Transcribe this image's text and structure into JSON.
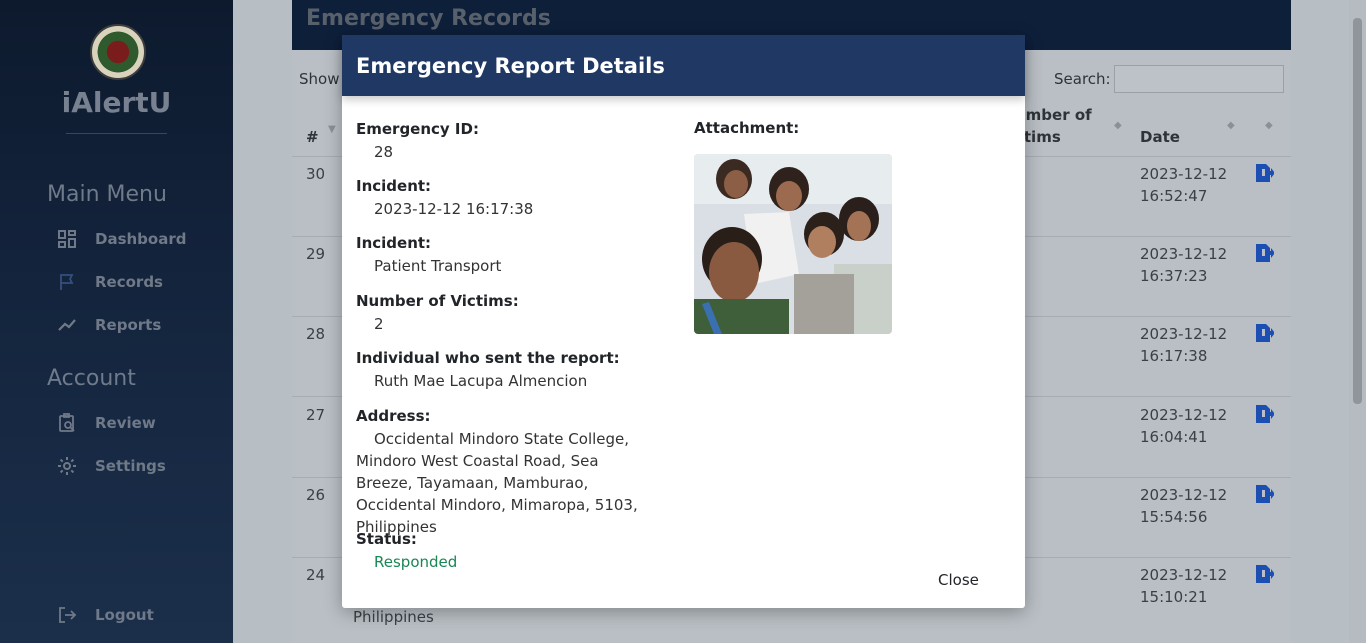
{
  "sidebar": {
    "brand": "iAlertU",
    "main_menu_title": "Main Menu",
    "items": [
      {
        "label": "Dashboard",
        "icon": "dashboard-icon"
      },
      {
        "label": "Records",
        "icon": "flag-icon"
      },
      {
        "label": "Reports",
        "icon": "trend-icon"
      }
    ],
    "account_title": "Account",
    "account_items": [
      {
        "label": "Review",
        "icon": "clipboard-search-icon"
      },
      {
        "label": "Settings",
        "icon": "gear-icon"
      }
    ],
    "logout_label": "Logout"
  },
  "page": {
    "title": "Emergency Records",
    "show_label": "Show",
    "search_label": "Search:",
    "search_value": "",
    "columns": {
      "index": "#",
      "victims_line1": "umber of",
      "victims_line2": "ctims",
      "date": "Date"
    },
    "rows": [
      {
        "index": "30",
        "date": "2023-12-12",
        "time": "16:52:47"
      },
      {
        "index": "29",
        "date": "2023-12-12",
        "time": "16:37:23"
      },
      {
        "index": "28",
        "date": "2023-12-12",
        "time": "16:17:38"
      },
      {
        "index": "27",
        "date": "2023-12-12",
        "time": "16:04:41"
      },
      {
        "index": "26",
        "date": "2023-12-12",
        "time": "15:54:56"
      },
      {
        "index": "24",
        "date": "2023-12-12",
        "time": "15:10:21"
      }
    ],
    "behind_text": "Philippines"
  },
  "modal": {
    "title": "Emergency Report Details",
    "emergency_id_label": "Emergency ID:",
    "emergency_id": "28",
    "incident_time_label": "Incident:",
    "incident_time": "2023-12-12 16:17:38",
    "incident_type_label": "Incident:",
    "incident_type": "Patient Transport",
    "victims_label": "Number of Victims:",
    "victims": "2",
    "sender_label": "Individual who sent the report:",
    "sender": "Ruth Mae Lacupa Almencion",
    "address_label": "Address:",
    "address": "Occidental Mindoro State College, Mindoro West Coastal Road, Sea Breeze, Tayamaan, Mamburao, Occidental Mindoro, Mimaropa, 5103, Philippines",
    "status_label": "Status:",
    "status": "Responded",
    "attachment_label": "Attachment:",
    "close_label": "Close"
  },
  "colors": {
    "modal_header": "#1f3864",
    "status_green": "#198754",
    "action_blue": "#1d4fb3"
  }
}
